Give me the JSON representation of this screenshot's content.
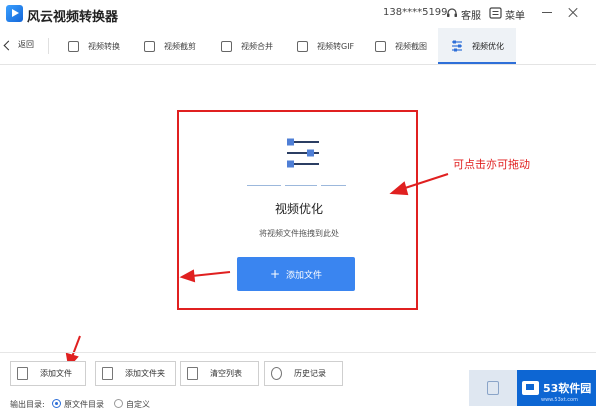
{
  "window": {
    "title": "风云视频转换器",
    "phone": "138****5199",
    "service_label": "客服",
    "menu_label": "菜单"
  },
  "toolbar": {
    "back_label": "返回",
    "tabs": [
      {
        "label": "视频转换"
      },
      {
        "label": "视频截剪"
      },
      {
        "label": "视频合并"
      },
      {
        "label": "视频转GIF"
      },
      {
        "label": "视频截图"
      },
      {
        "label": "视频优化",
        "active": true
      }
    ]
  },
  "main": {
    "title": "视频优化",
    "hint": "将视频文件拖拽到此处",
    "add_file_label": "添加文件",
    "annotation": "可点击亦可拖动"
  },
  "bottom": {
    "buttons": [
      {
        "label": "添加文件"
      },
      {
        "label": "添加文件夹"
      },
      {
        "label": "清空列表"
      },
      {
        "label": "历史记录"
      }
    ],
    "output_label": "输出目录:",
    "radio_options": [
      {
        "label": "原文件目录",
        "checked": true
      },
      {
        "label": "自定义",
        "checked": false
      }
    ]
  },
  "watermark": {
    "text": "53软件园",
    "sub": "www.53xt.com"
  },
  "colors": {
    "accent": "#3a85f0",
    "annotation_red": "#e02020",
    "watermark_blue": "#0d66d3"
  }
}
